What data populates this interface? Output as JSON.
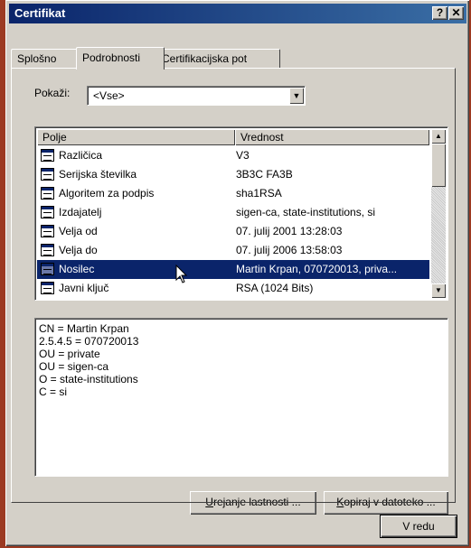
{
  "window": {
    "title": "Certifikat",
    "help_label": "?",
    "close_label": "✕"
  },
  "tabs": [
    {
      "label": "Splošno"
    },
    {
      "label": "Podrobnosti"
    },
    {
      "label": "Certifikacijska pot"
    }
  ],
  "show": {
    "label": "Pokaži:",
    "value": "<Vse>"
  },
  "list": {
    "columns": [
      "Polje",
      "Vrednost"
    ],
    "rows": [
      {
        "field": "Različica",
        "value": "V3"
      },
      {
        "field": "Serijska številka",
        "value": "3B3C FA3B"
      },
      {
        "field": "Algoritem za podpis",
        "value": "sha1RSA"
      },
      {
        "field": "Izdajatelj",
        "value": "sigen-ca, state-institutions, si"
      },
      {
        "field": "Velja od",
        "value": "07. julij 2001 13:28:03"
      },
      {
        "field": "Velja do",
        "value": "07. julij 2006 13:58:03"
      },
      {
        "field": "Nosilec",
        "value": "Martin Krpan, 070720013, priva..."
      },
      {
        "field": "Javni ključ",
        "value": "RSA (1024 Bits)"
      }
    ],
    "selected_index": 6
  },
  "details": [
    "CN = Martin Krpan",
    "2.5.4.5 = 070720013",
    "OU = private",
    "OU = sigen-ca",
    "O = state-institutions",
    "C = si"
  ],
  "buttons": {
    "edit_u": "U",
    "edit_rest": "rejanje lastnosti ...",
    "copy_u": "K",
    "copy_rest": "opiraj v datoteko ...",
    "ok": "V redu"
  }
}
